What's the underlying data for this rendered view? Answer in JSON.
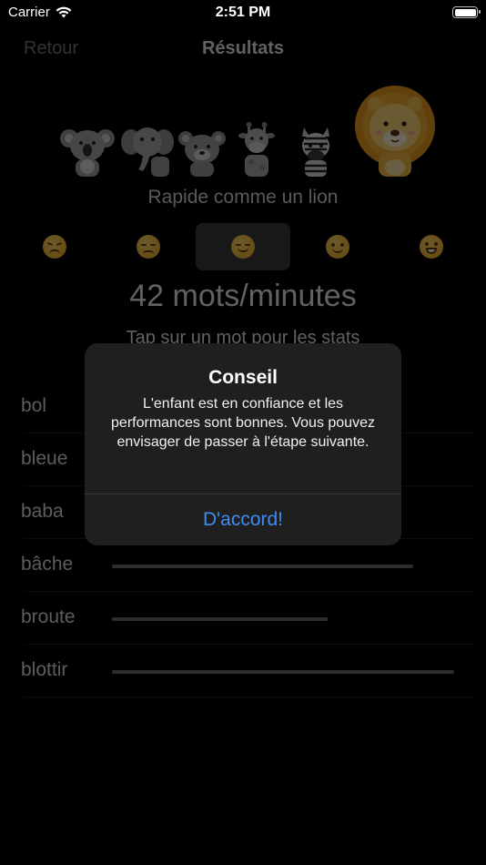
{
  "status": {
    "carrier": "Carrier",
    "time": "2:51 PM"
  },
  "nav": {
    "back_label": "Retour",
    "title": "Résultats"
  },
  "animals": [
    "koala",
    "elephant",
    "bear",
    "giraffe",
    "zebra",
    "lion"
  ],
  "speed_label": "Rapide comme un lion",
  "moods": [
    "very-unhappy",
    "unhappy",
    "relieved",
    "smiling",
    "grinning"
  ],
  "selected_mood": 2,
  "speed": "42 mots/minutes",
  "hint": "Tap sur un mot pour les stats",
  "words": [
    {
      "label": "bol",
      "fraction": 0
    },
    {
      "label": "bleue",
      "fraction": 0
    },
    {
      "label": "baba",
      "fraction": 0
    },
    {
      "label": "bâche",
      "fraction": 0.88
    },
    {
      "label": "broute",
      "fraction": 0.63
    },
    {
      "label": "blottir",
      "fraction": 1.0
    }
  ],
  "alert": {
    "title": "Conseil",
    "message": "L'enfant est en confiance et les performances sont bonnes. Vous pouvez envisager de passer à l'étape suivante.",
    "button": "D'accord!"
  }
}
